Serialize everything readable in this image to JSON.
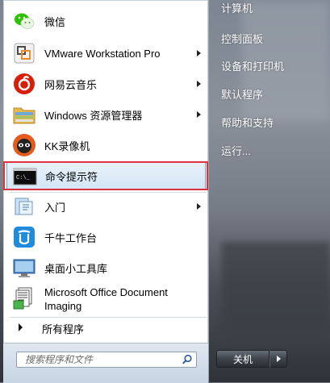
{
  "programs": [
    {
      "label": "微信",
      "icon": "wechat-icon",
      "has_submenu": false
    },
    {
      "label": "VMware Workstation Pro",
      "icon": "vmware-icon",
      "has_submenu": true
    },
    {
      "label": "网易云音乐",
      "icon": "netease-music-icon",
      "has_submenu": true
    },
    {
      "label": "Windows 资源管理器",
      "icon": "file-explorer-icon",
      "has_submenu": true
    },
    {
      "label": "KK录像机",
      "icon": "kk-recorder-icon",
      "has_submenu": false
    },
    {
      "label": "命令提示符",
      "icon": "command-prompt-icon",
      "has_submenu": false,
      "highlighted": true
    },
    {
      "label": "入门",
      "icon": "getting-started-icon",
      "has_submenu": true
    },
    {
      "label": "千牛工作台",
      "icon": "qianniu-icon",
      "has_submenu": false
    },
    {
      "label": "桌面小工具库",
      "icon": "gadgets-icon",
      "has_submenu": false
    },
    {
      "label_line1": "Microsoft Office Document",
      "label_line2": "Imaging",
      "icon": "office-imaging-icon",
      "has_submenu": false
    }
  ],
  "all_programs": "所有程序",
  "search": {
    "placeholder": "搜索程序和文件"
  },
  "right_links": [
    "计算机",
    "控制面板",
    "设备和打印机",
    "默认程序",
    "帮助和支持",
    "运行..."
  ],
  "shutdown": {
    "label": "关机"
  },
  "colors": {
    "highlight_border": "#e0323c",
    "hover_bg": "#d3e5f6",
    "panel_bg": "#ffffff"
  }
}
